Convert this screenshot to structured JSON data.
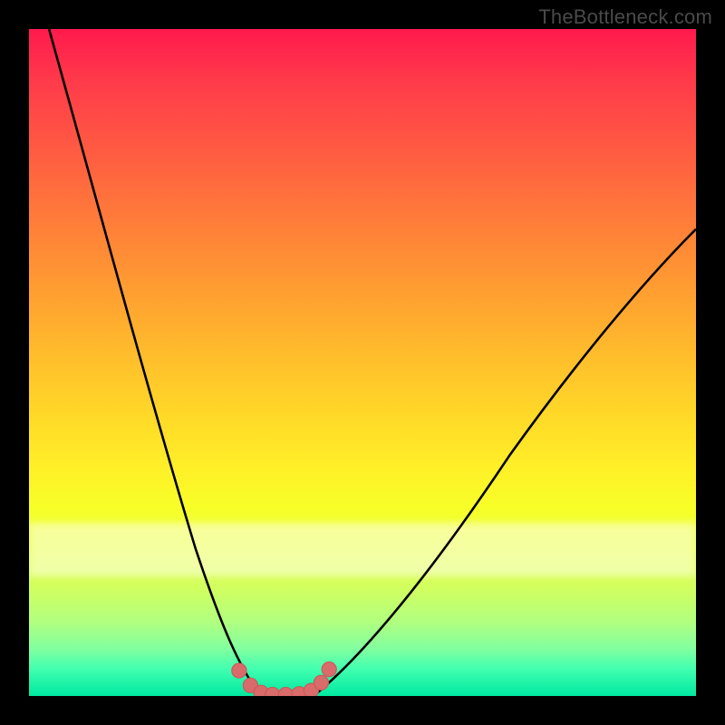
{
  "watermark": "TheBottleneck.com",
  "colors": {
    "frame": "#000000",
    "curve": "#000000",
    "dots": "#d96b6b",
    "dots_stroke": "#c85a5a"
  },
  "chart_data": {
    "type": "line",
    "title": "",
    "xlabel": "",
    "ylabel": "",
    "xlim": [
      0,
      100
    ],
    "ylim": [
      0,
      100
    ],
    "grid": false,
    "legend": false,
    "series": [
      {
        "name": "bottleneck-curve-left",
        "x": [
          3,
          6,
          9,
          12,
          15,
          18,
          21,
          24,
          27,
          29,
          31,
          33,
          34.5
        ],
        "values": [
          100,
          86,
          73,
          60,
          48,
          37,
          27,
          19,
          12,
          7,
          3.5,
          1.3,
          0.3
        ]
      },
      {
        "name": "bottleneck-curve-right",
        "x": [
          43,
          46,
          50,
          54,
          58,
          63,
          68,
          73,
          78,
          84,
          90,
          96,
          100
        ],
        "values": [
          0.3,
          2,
          5,
          9,
          14,
          20,
          27,
          34,
          41,
          49,
          57,
          65,
          70
        ]
      },
      {
        "name": "flat-bottom",
        "x": [
          34.5,
          36,
          38,
          40,
          42,
          43
        ],
        "values": [
          0.3,
          0,
          0,
          0,
          0,
          0.3
        ]
      }
    ],
    "dots": {
      "name": "bottleneck-markers",
      "x": [
        31.5,
        33.2,
        34.8,
        36.5,
        38.5,
        40.5,
        42.3,
        43.8,
        45.0
      ],
      "values": [
        3.8,
        1.6,
        0.5,
        0.2,
        0.2,
        0.3,
        0.8,
        2.0,
        4.0
      ]
    },
    "band": {
      "y_start": 74,
      "y_end": 82,
      "note": "pale horizontal band near green zone"
    }
  }
}
